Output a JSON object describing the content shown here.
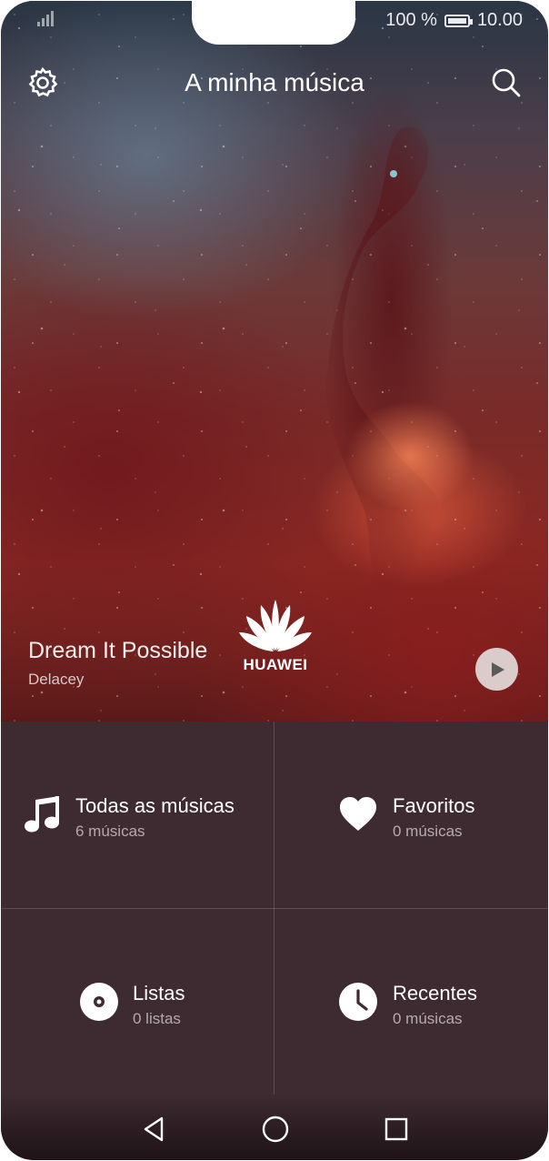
{
  "status_bar": {
    "battery": "100 %",
    "time": "10.00",
    "signal_icon": "signal-icon",
    "battery_icon": "battery-icon"
  },
  "header": {
    "title": "A minha música",
    "settings_icon": "gear-icon",
    "search_icon": "search-icon"
  },
  "now_playing": {
    "title": "Dream It Possible",
    "artist": "Delacey",
    "logo_text": "HUAWEI",
    "play_icon": "play-icon"
  },
  "categories": [
    {
      "label": "Todas as músicas",
      "count": "6 músicas",
      "icon": "music-note-icon"
    },
    {
      "label": "Favoritos",
      "count": "0 músicas",
      "icon": "heart-icon"
    },
    {
      "label": "Listas",
      "count": "0 listas",
      "icon": "disc-icon"
    },
    {
      "label": "Recentes",
      "count": "0 músicas",
      "icon": "clock-icon"
    }
  ],
  "nav_bar": {
    "back_icon": "back-triangle-icon",
    "home_icon": "home-circle-icon",
    "recents_icon": "recents-square-icon"
  },
  "colors": {
    "panel": "#3e2a31",
    "text": "#ffffff",
    "subtext": "#b5a9ad"
  }
}
